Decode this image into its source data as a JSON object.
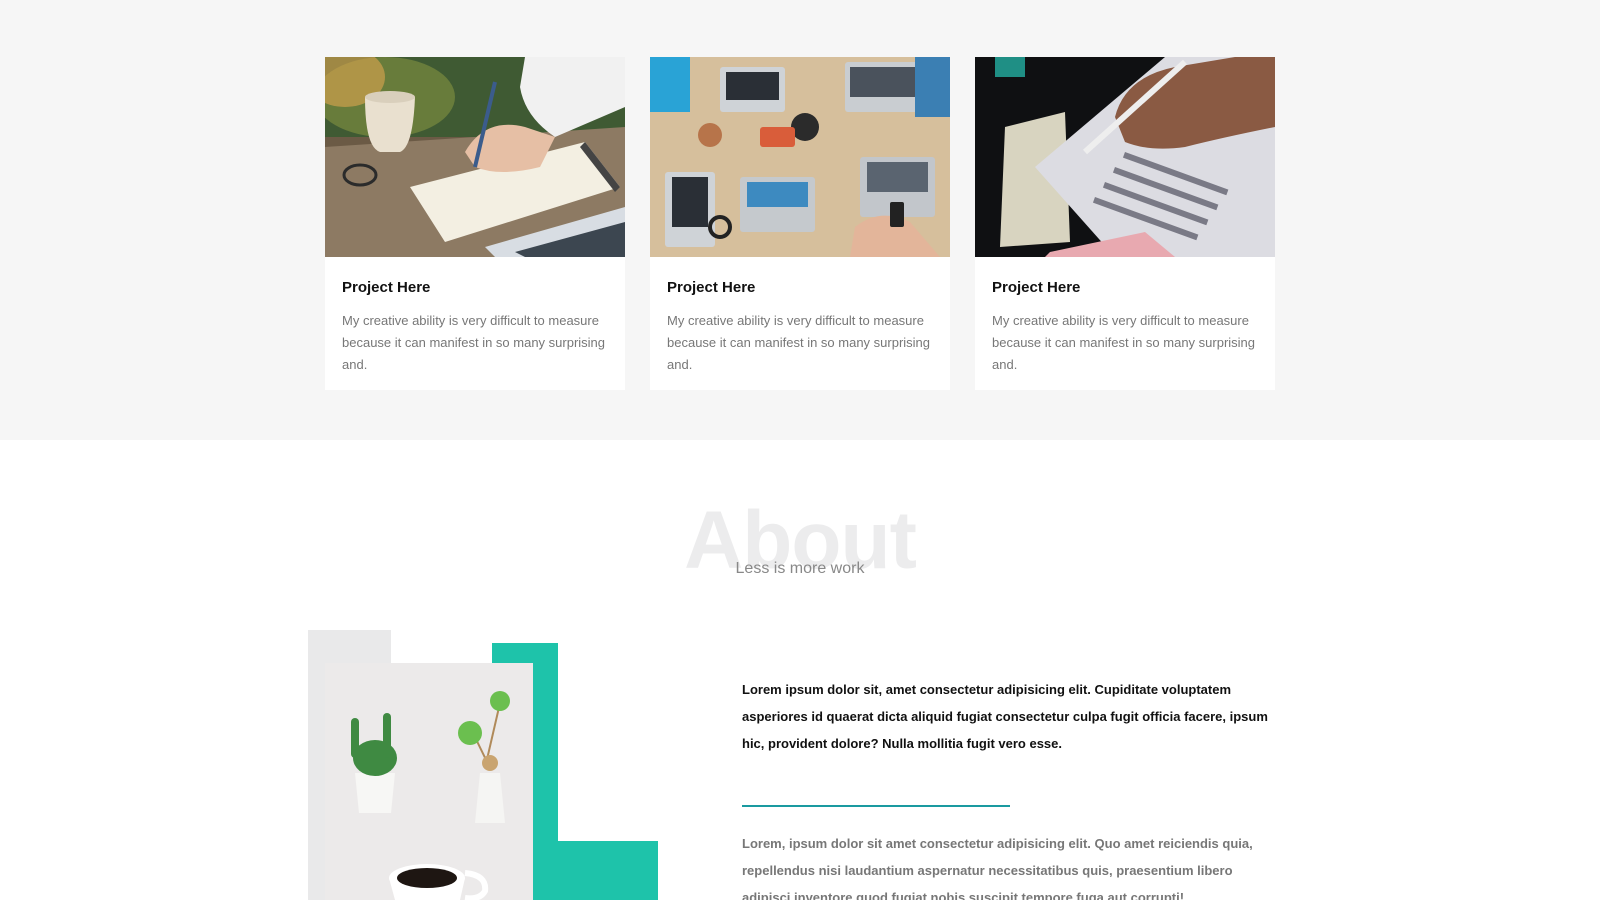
{
  "projects": [
    {
      "title": "Project Here",
      "description": "My creative ability is very difficult to measure because it can manifest in so many surprising and.",
      "image": "notebook-writing-photo"
    },
    {
      "title": "Project Here",
      "description": "My creative ability is very difficult to measure because it can manifest in so many surprising and.",
      "image": "team-laptops-desk-photo"
    },
    {
      "title": "Project Here",
      "description": "My creative ability is very difficult to measure because it can manifest in so many surprising and.",
      "image": "answer-sheet-pencil-photo"
    }
  ],
  "about": {
    "title": "About",
    "subtitle": "Less is more work",
    "lead": "Lorem ipsum dolor sit, amet consectetur adipisicing elit. Cupiditate voluptatem asperiores id quaerat dicta aliquid fugiat consectetur culpa fugit officia facere, ipsum hic, provident dolore? Nulla mollitia fugit vero esse.",
    "body": "Lorem, ipsum dolor sit amet consectetur adipisicing elit. Quo amet reiciendis quia, repellendus nisi laudantium aspernatur necessitatibus quis, praesentium libero adipisci inventore quod fugiat nobis suscipit tempore fuga aut corrupti!",
    "image": "succulents-coffee-photo"
  },
  "colors": {
    "accent": "#1ec3aa",
    "rule": "#1a9aa0",
    "section_bg": "#f6f6f6"
  }
}
